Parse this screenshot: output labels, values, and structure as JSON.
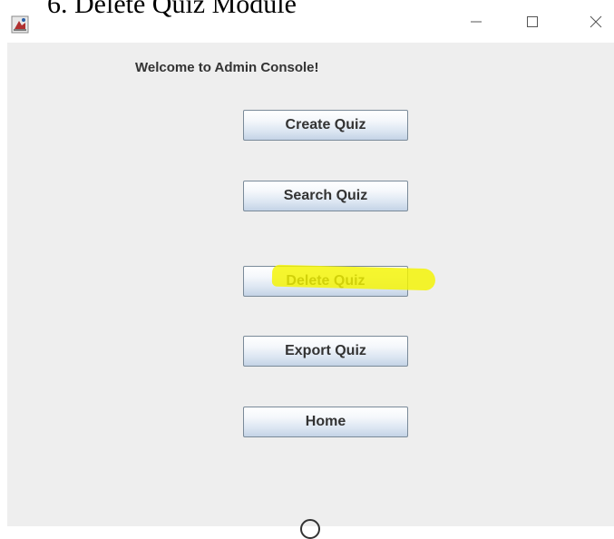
{
  "document": {
    "heading": "6.   Delete Quiz Module"
  },
  "window": {
    "icon": "java-app-icon",
    "controls": {
      "minimize_icon": "minimize-icon",
      "maximize_icon": "maximize-icon",
      "close_icon": "close-icon"
    }
  },
  "console": {
    "welcome": "Welcome to Admin Console!",
    "buttons": {
      "create": "Create Quiz",
      "search": "Search Quiz",
      "delete": "Delete Quiz",
      "export": "Export Quiz",
      "home": "Home"
    },
    "highlight_color": "#f4f400"
  },
  "colors": {
    "panel_background": "#eeeeee",
    "button_border": "#7a8a99",
    "text": "#333333"
  }
}
